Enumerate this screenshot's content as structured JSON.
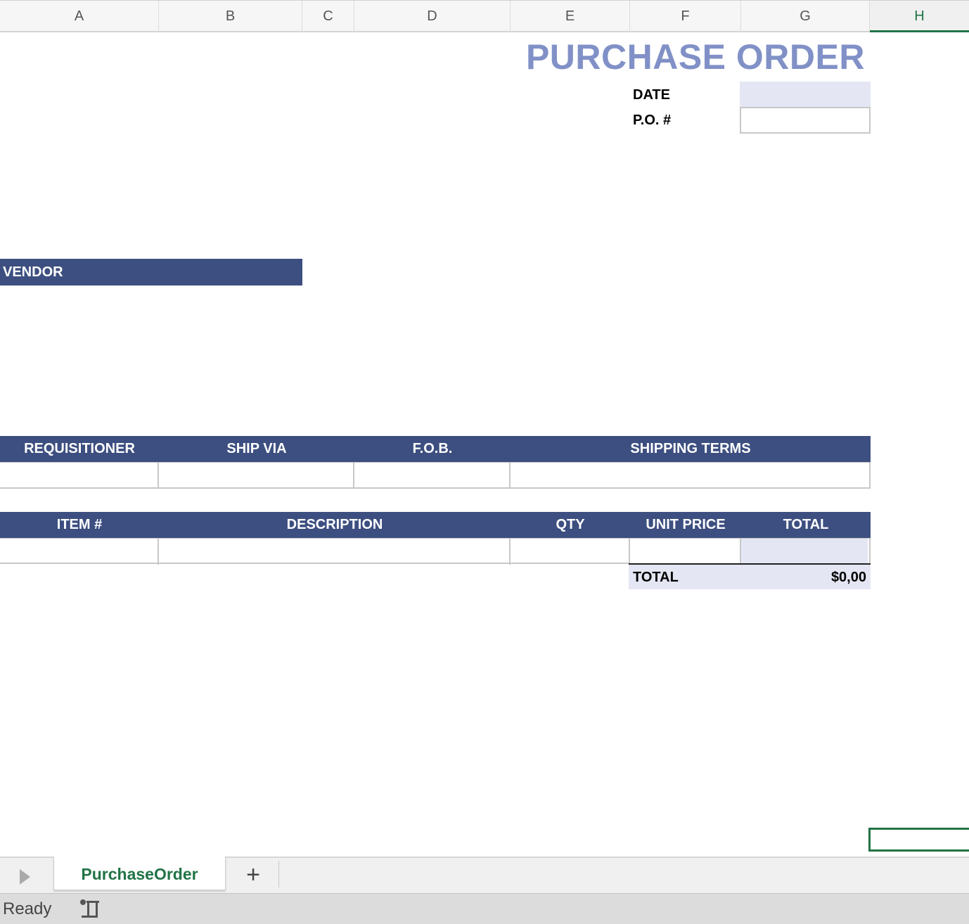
{
  "columns": [
    "A",
    "B",
    "C",
    "D",
    "E",
    "F",
    "G",
    "H"
  ],
  "active_column": "H",
  "sheet": {
    "title": "PURCHASE ORDER",
    "date_label": "DATE",
    "po_label": "P.O. #",
    "vendor_label": "VENDOR",
    "shipping_headers": [
      "REQUISITIONER",
      "SHIP VIA",
      "F.O.B.",
      "SHIPPING TERMS"
    ],
    "item_headers": [
      "ITEM #",
      "DESCRIPTION",
      "QTY",
      "UNIT PRICE",
      "TOTAL"
    ],
    "total_label": "TOTAL",
    "total_value": "$0,00"
  },
  "tabs": {
    "active_sheet": "PurchaseOrder",
    "add_label": "+"
  },
  "status": {
    "text": "Ready"
  },
  "colors": {
    "header_band": "#3d4f80",
    "title": "#8191c7",
    "highlight_fill": "#e4e6f3",
    "excel_green": "#217346"
  },
  "icons": {
    "sheet_nav": "play-triangle-icon",
    "macro": "macro-recorder-icon"
  }
}
